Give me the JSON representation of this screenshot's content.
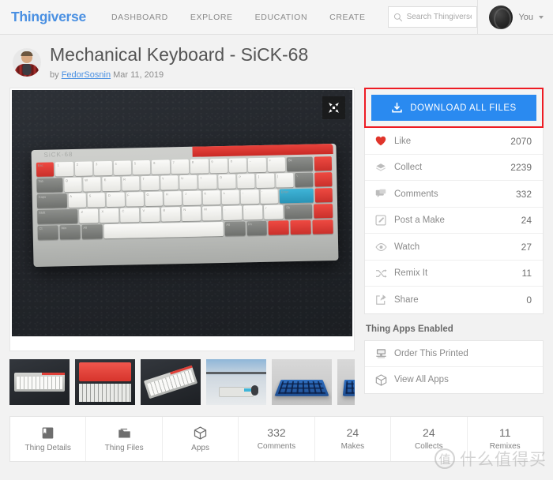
{
  "nav": {
    "brand": "Thingiverse",
    "links": [
      "DASHBOARD",
      "EXPLORE",
      "EDUCATION",
      "CREATE"
    ],
    "search_placeholder": "Search Thingiverse",
    "search_value": "",
    "user_label": "You"
  },
  "thing": {
    "title": "Mechanical Keyboard - SiCK-68",
    "by_prefix": "by",
    "author": "FedorSosnin",
    "date": "Mar 11, 2019"
  },
  "gallery": {
    "expand_label": "expand",
    "thumbnails": [
      {
        "name": "keyboard-top-dark"
      },
      {
        "name": "red-plates"
      },
      {
        "name": "keyboard-angled"
      },
      {
        "name": "desk-setup"
      },
      {
        "name": "blue-print-plate"
      },
      {
        "name": "blue-print-plate-2"
      }
    ]
  },
  "download": {
    "label": "DOWNLOAD ALL FILES",
    "color": "#2a8af0",
    "highlight_color": "#ee1c24"
  },
  "stats": [
    {
      "icon": "heart-icon",
      "label": "Like",
      "value": "2070",
      "color": "#e0352b"
    },
    {
      "icon": "collect-icon",
      "label": "Collect",
      "value": "2239",
      "color": "#b7b7b7"
    },
    {
      "icon": "comment-icon",
      "label": "Comments",
      "value": "332",
      "color": "#b7b7b7"
    },
    {
      "icon": "make-icon",
      "label": "Post a Make",
      "value": "24",
      "color": "#b7b7b7"
    },
    {
      "icon": "eye-icon",
      "label": "Watch",
      "value": "27",
      "color": "#b7b7b7"
    },
    {
      "icon": "remix-icon",
      "label": "Remix It",
      "value": "11",
      "color": "#b7b7b7"
    },
    {
      "icon": "share-icon",
      "label": "Share",
      "value": "0",
      "color": "#b7b7b7"
    }
  ],
  "apps": {
    "section_title": "Thing Apps Enabled",
    "items": [
      {
        "icon": "printer-icon",
        "label": "Order This Printed"
      },
      {
        "icon": "cube-icon",
        "label": "View All Apps"
      }
    ]
  },
  "tabs": [
    {
      "icon": "book-icon",
      "num": "",
      "label": "Thing Details"
    },
    {
      "icon": "folder-icon",
      "num": "",
      "label": "Thing Files"
    },
    {
      "icon": "cube-icon",
      "num": "",
      "label": "Apps"
    },
    {
      "icon": "",
      "num": "332",
      "label": "Comments"
    },
    {
      "icon": "",
      "num": "24",
      "label": "Makes"
    },
    {
      "icon": "",
      "num": "24",
      "label": "Collects"
    },
    {
      "icon": "",
      "num": "11",
      "label": "Remixes"
    }
  ],
  "watermark": {
    "mark": "值",
    "text": "什么值得买"
  }
}
